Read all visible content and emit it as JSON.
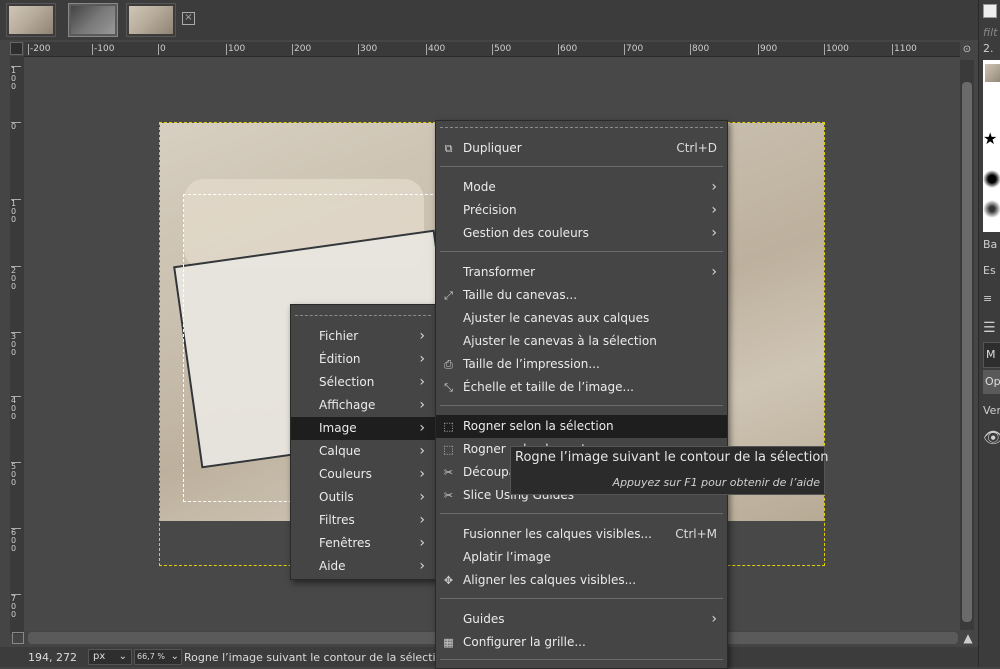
{
  "status": {
    "coords": "194, 272",
    "unit": "px",
    "zoom": "66,7 %",
    "message": "Rogne l’image suivant le contour de la sélection"
  },
  "ruler": {
    "h_ticks": [
      "-200",
      "-100",
      "0",
      "100",
      "200",
      "300",
      "400",
      "500",
      "600",
      "700",
      "800",
      "900",
      "1000",
      "1100"
    ],
    "v_ticks": [
      "100",
      "0",
      "100",
      "200",
      "300",
      "400",
      "500",
      "600",
      "700",
      "800"
    ]
  },
  "main_menu": {
    "items": [
      {
        "label": "Fichier"
      },
      {
        "label": "Édition"
      },
      {
        "label": "Sélection"
      },
      {
        "label": "Affichage"
      },
      {
        "label": "Image"
      },
      {
        "label": "Calque"
      },
      {
        "label": "Couleurs"
      },
      {
        "label": "Outils"
      },
      {
        "label": "Filtres"
      },
      {
        "label": "Fenêtres"
      },
      {
        "label": "Aide"
      }
    ]
  },
  "image_menu": {
    "items": [
      {
        "label": "Dupliquer",
        "accel": "Ctrl+D"
      },
      {
        "label": "Mode"
      },
      {
        "label": "Précision"
      },
      {
        "label": "Gestion des couleurs"
      },
      {
        "label": "Transformer"
      },
      {
        "label": "Taille du canevas..."
      },
      {
        "label": "Ajuster le canevas aux calques"
      },
      {
        "label": "Ajuster le canevas à la sélection"
      },
      {
        "label": "Taille de l’impression..."
      },
      {
        "label": "Échelle et taille de l’image..."
      },
      {
        "label": "Rogner selon la sélection"
      },
      {
        "label": "Rogner selon le contenu"
      },
      {
        "label": "Découpage"
      },
      {
        "label": "Slice Using Guides"
      },
      {
        "label": "Fusionner les calques visibles...",
        "accel": "Ctrl+M"
      },
      {
        "label": "Aplatir l’image"
      },
      {
        "label": "Aligner les calques visibles..."
      },
      {
        "label": "Guides"
      },
      {
        "label": "Configurer la grille..."
      }
    ]
  },
  "tooltip": {
    "title": "Rogne l’image suivant le contour de la sélection",
    "hint": "Appuyez sur F1 pour obtenir de l’aide"
  },
  "dock": {
    "filter_text": "filt",
    "count_label": "2.",
    "ba": "Ba",
    "es": "Es",
    "mode": "M",
    "opacity": "Op",
    "lock": "Ver"
  }
}
